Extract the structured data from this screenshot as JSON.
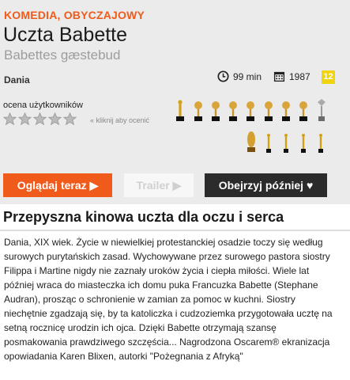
{
  "movie": {
    "genre": "KOMEDIA, OBYCZAJOWY",
    "title": "Uczta Babette",
    "original_title": "Babettes gæstebud",
    "country": "Dania",
    "duration": "99 min",
    "year": "1987",
    "age_rating": "12"
  },
  "rating": {
    "label": "ocena użytkowników",
    "stars_filled": 0,
    "stars_total": 5,
    "hint": "« kliknij aby ocenić"
  },
  "awards": {
    "row1": [
      "oscar",
      "globe",
      "globe",
      "globe",
      "globe",
      "globe",
      "globe",
      "globe",
      "emmy"
    ],
    "row2": [
      "bafta",
      "globe",
      "globe",
      "globe",
      "globe"
    ]
  },
  "buttons": {
    "watch": "Oglądaj teraz ▶",
    "trailer": "Trailer ▶",
    "later": "Obejrzyj później ♥"
  },
  "headline": "Przepyszna kinowa uczta dla oczu i serca",
  "description": "Dania, XIX wiek. Życie w niewielkiej protestanckiej osadzie toczy się według surowych purytańskich zasad. Wychowywane przez surowego pastora siostry Filippa i Martine nigdy nie zaznały uroków życia i ciepła miłości. Wiele lat później wraca do miasteczka ich domu puka Francuzka Babette (Stephane Audran), prosząc o schronienie w zamian za pomoc w kuchni. Siostry niechętnie zgadzają się, by ta katoliczka i cudzoziemka przygotowała ucztę na setną rocznicę urodzin ich ojca. Dzięki Babette otrzymają szansę posmakowania prawdziwego szczęścia... Nagrodzona Oscarem® ekranizacja opowiadania Karen Blixen, autorki \"Pożegnania z Afryką\"",
  "colors": {
    "accent": "#f05a1a",
    "header_bg": "#ebebeb",
    "dark_button": "#2b2b2b",
    "age_badge": "#f2d40a"
  }
}
